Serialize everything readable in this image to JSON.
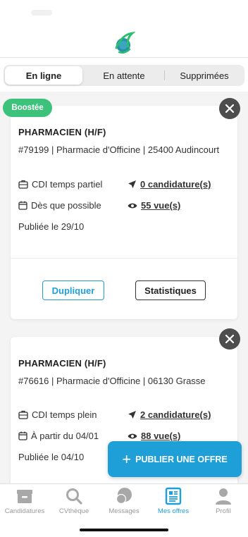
{
  "tabs": [
    {
      "label": "En ligne",
      "active": true
    },
    {
      "label": "En attente",
      "active": false
    },
    {
      "label": "Supprimées",
      "active": false
    }
  ],
  "offers": [
    {
      "badge": "Boostée",
      "title": "PHARMACIEN (H/F)",
      "ref": "#79199 | Pharmacie d'Officine | 25400 Audincourt",
      "contract": "CDI temps partiel",
      "applications": "0 candidature(s)",
      "start": "Dès que possible",
      "views": "55 vue(s)",
      "published": "Publiée le 29/10",
      "duplicate_label": "Dupliquer",
      "stats_label": "Statistiques"
    },
    {
      "title": "PHARMACIEN (H/F)",
      "ref": "#76616 | Pharmacie d'Officine | 06130 Grasse",
      "contract": "CDI temps plein",
      "applications": "2 candidature(s)",
      "start": "À partir du 04/01",
      "views": "88 vue(s)",
      "published": "Publiée le 04/10"
    }
  ],
  "fab": {
    "label": "PUBLIER UNE OFFRE"
  },
  "nav": [
    {
      "label": "Candidatures",
      "icon": "inbox-icon",
      "active": false
    },
    {
      "label": "CVthèque",
      "icon": "search-icon",
      "active": false
    },
    {
      "label": "Messages",
      "icon": "chat-icon",
      "active": false
    },
    {
      "label": "Mes offres",
      "icon": "newspaper-icon",
      "active": true
    },
    {
      "label": "Profil",
      "icon": "user-icon",
      "active": false
    }
  ],
  "colors": {
    "accent": "#1f9fd8",
    "boost": "#3cc27a",
    "close": "#4d4d4d"
  }
}
